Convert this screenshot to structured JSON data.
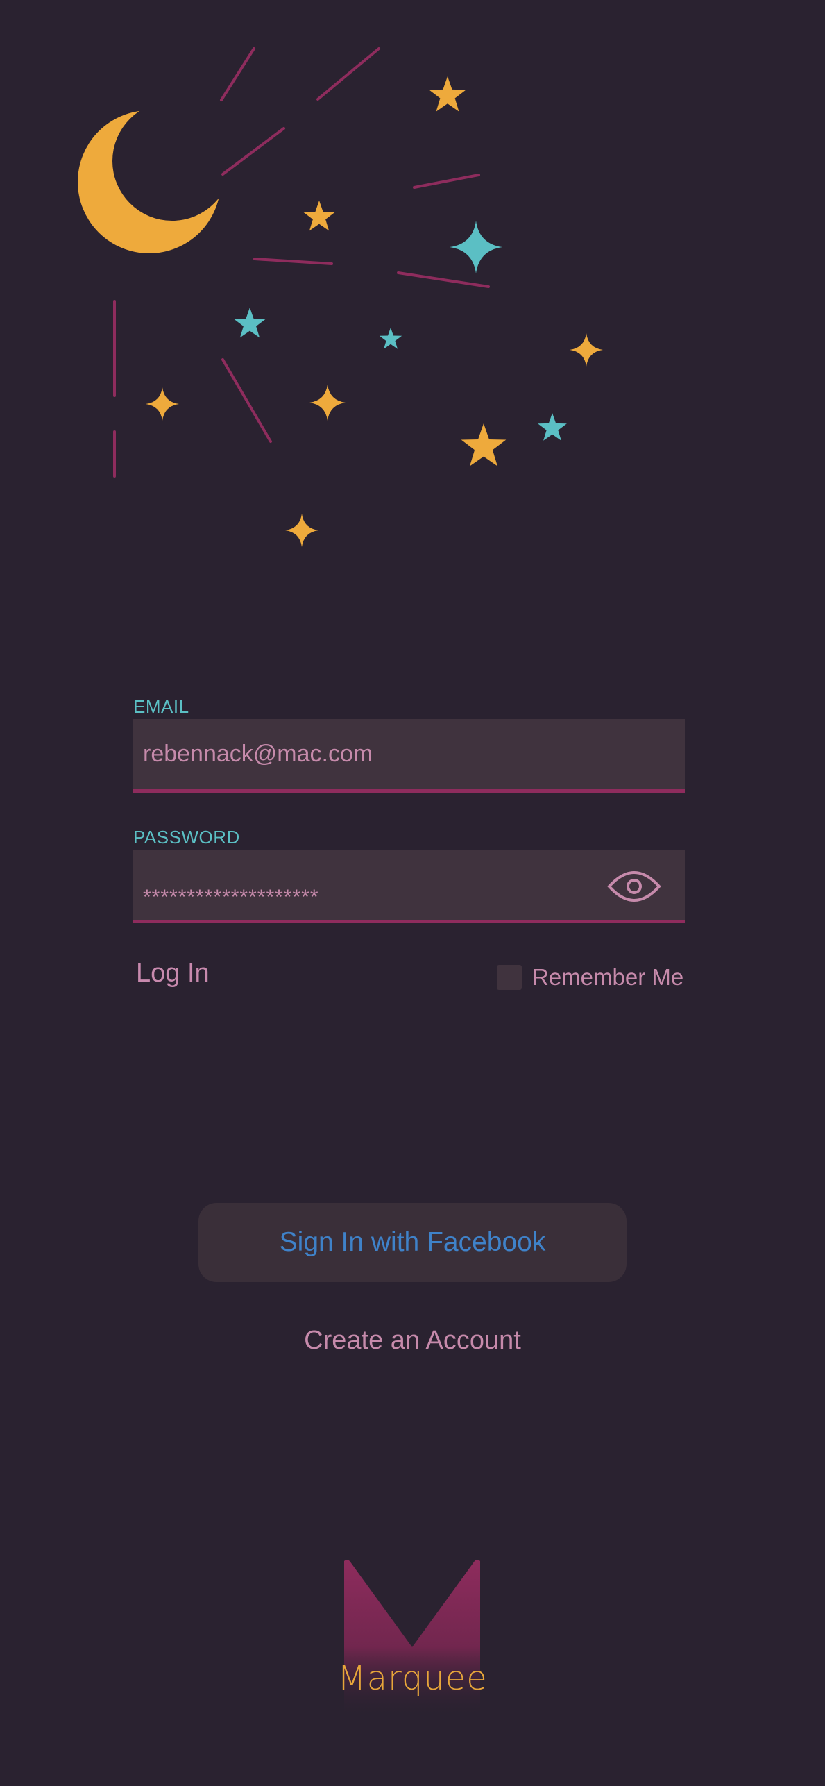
{
  "colors": {
    "background": "#2a2230",
    "label_teal": "#5bbfc4",
    "text_pink": "#c68aab",
    "accent_magenta": "#8e2c5d",
    "facebook_blue": "#3f82c9",
    "moon_gold": "#eeaa3c"
  },
  "illustration": {
    "icons": [
      "moon-icon",
      "star-icon",
      "shooting-line"
    ]
  },
  "form": {
    "email": {
      "label": "EMAIL",
      "value": "rebennack@mac.com"
    },
    "password": {
      "label": "PASSWORD",
      "masked_value": "********************",
      "toggle_icon": "eye-icon"
    },
    "login_label": "Log In",
    "remember_label": "Remember Me",
    "remember_checked": false
  },
  "actions": {
    "facebook_label": "Sign In with Facebook",
    "create_account_label": "Create an Account"
  },
  "branding": {
    "logo_icon": "marquee-m-logo",
    "logo_text": "Marquee"
  }
}
